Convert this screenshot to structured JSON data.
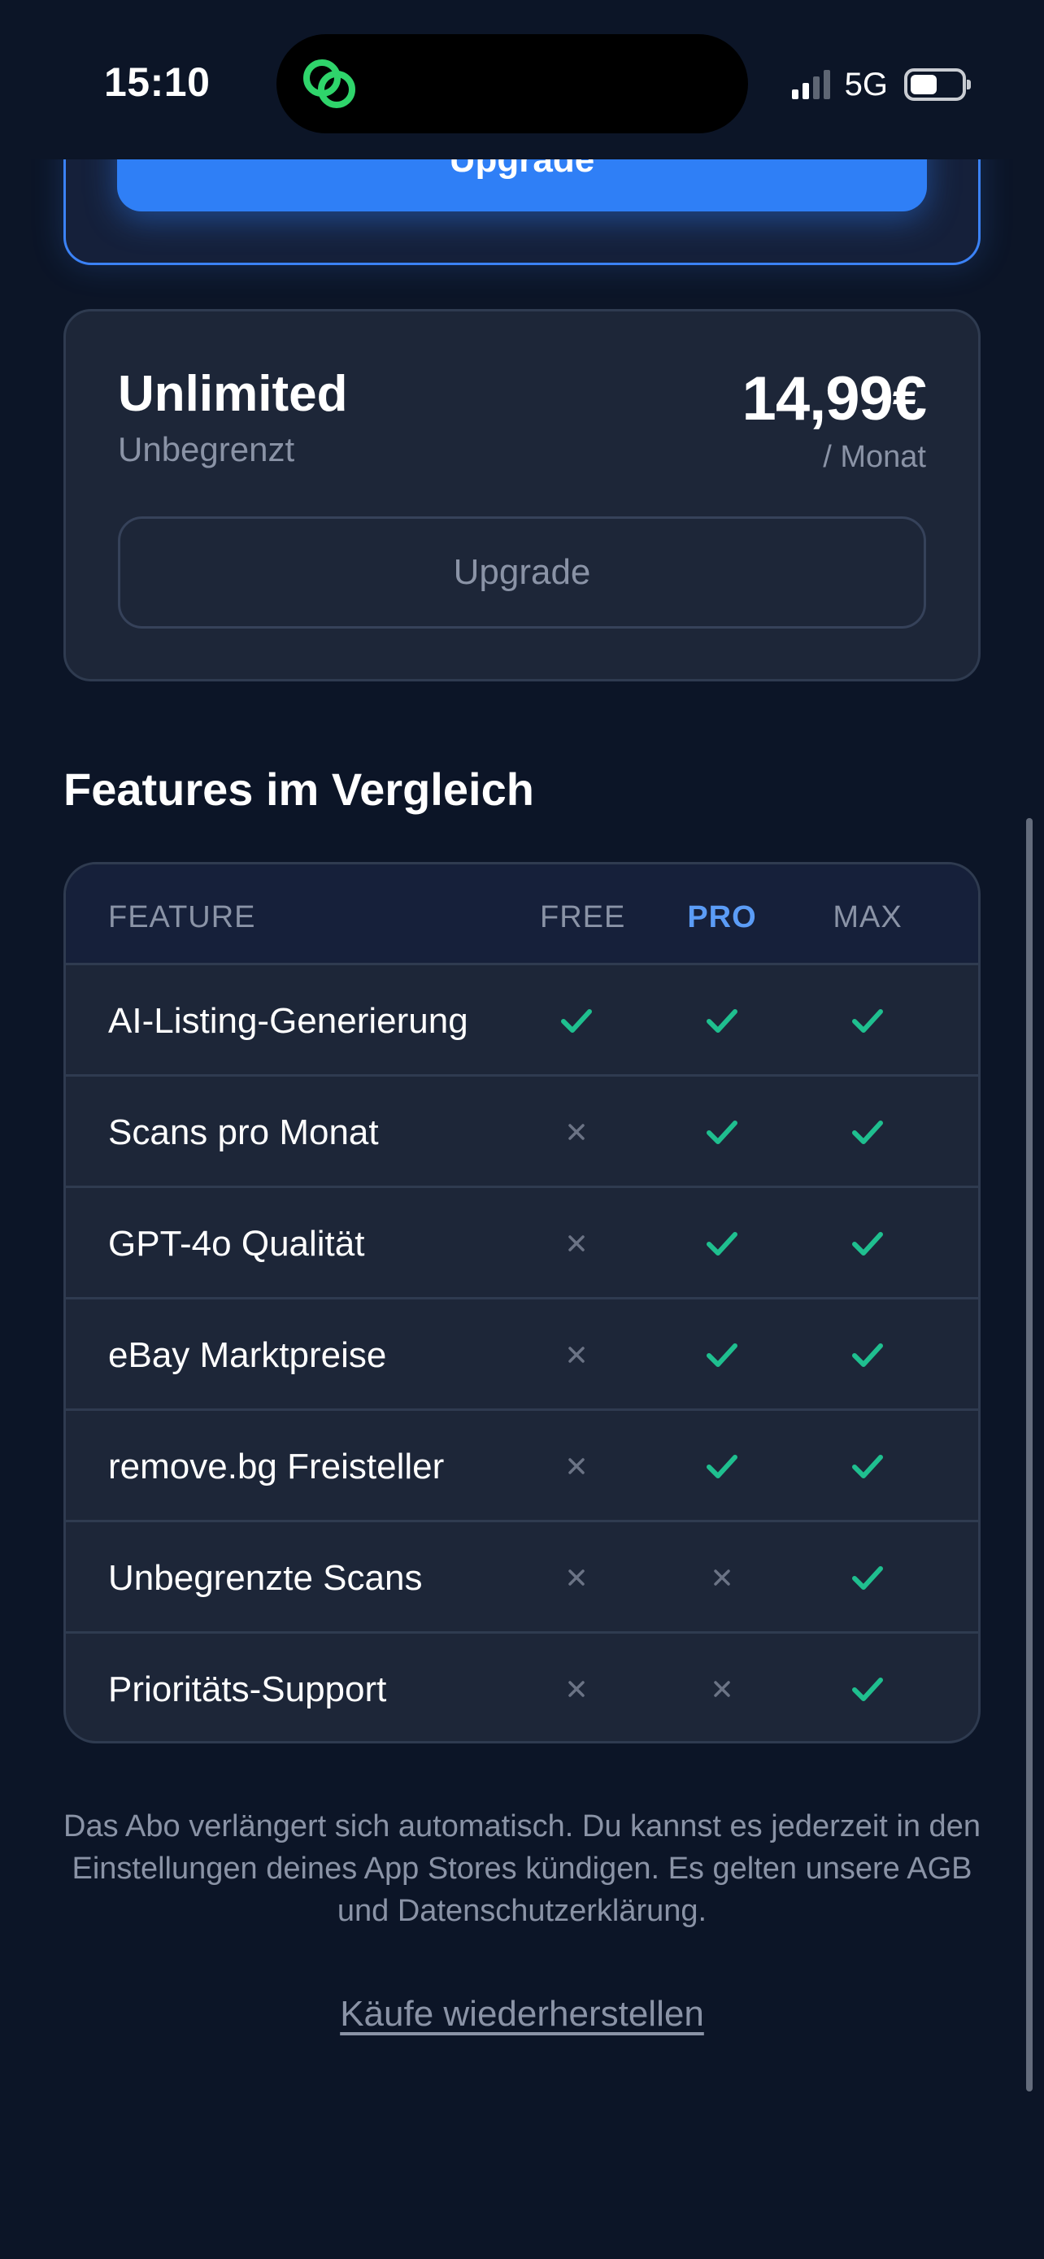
{
  "status_bar": {
    "time": "15:10",
    "network": "5G",
    "icons": [
      "app-activity-icon",
      "signal-icon",
      "battery-icon"
    ]
  },
  "pro_plan": {
    "upgrade_label": "Upgrade"
  },
  "unlimited_plan": {
    "name": "Unlimited",
    "subtitle": "Unbegrenzt",
    "price": "14,99€",
    "period": "/ Monat",
    "upgrade_label": "Upgrade"
  },
  "comparison": {
    "title": "Features im Vergleich",
    "headers": {
      "feature": "FEATURE",
      "free": "FREE",
      "pro": "PRO",
      "max": "MAX"
    },
    "rows": [
      {
        "feature": "AI-Listing-Generierung",
        "free": true,
        "pro": true,
        "max": true
      },
      {
        "feature": "Scans pro Monat",
        "free": false,
        "pro": true,
        "max": true
      },
      {
        "feature": "GPT-4o Qualität",
        "free": false,
        "pro": true,
        "max": true
      },
      {
        "feature": "eBay Marktpreise",
        "free": false,
        "pro": true,
        "max": true
      },
      {
        "feature": "remove.bg Freisteller",
        "free": false,
        "pro": true,
        "max": true
      },
      {
        "feature": "Unbegrenzte Scans",
        "free": false,
        "pro": false,
        "max": true
      },
      {
        "feature": "Prioritäts-Support",
        "free": false,
        "pro": false,
        "max": true
      }
    ]
  },
  "footer": {
    "legal": "Das Abo verlängert sich automatisch. Du kannst es jederzeit in den Einstellungen deines App Stores kündigen. Es gelten unsere AGB und Datenschutzerklärung.",
    "restore_label": "Käufe wiederherstellen"
  },
  "colors": {
    "background": "#0c1527",
    "card": "#1d2638",
    "accent": "#2f7ff6",
    "pro_header": "#5b9cf6",
    "check": "#1fbf8f",
    "cross": "#6b7385",
    "muted_text": "#8a93a6"
  }
}
